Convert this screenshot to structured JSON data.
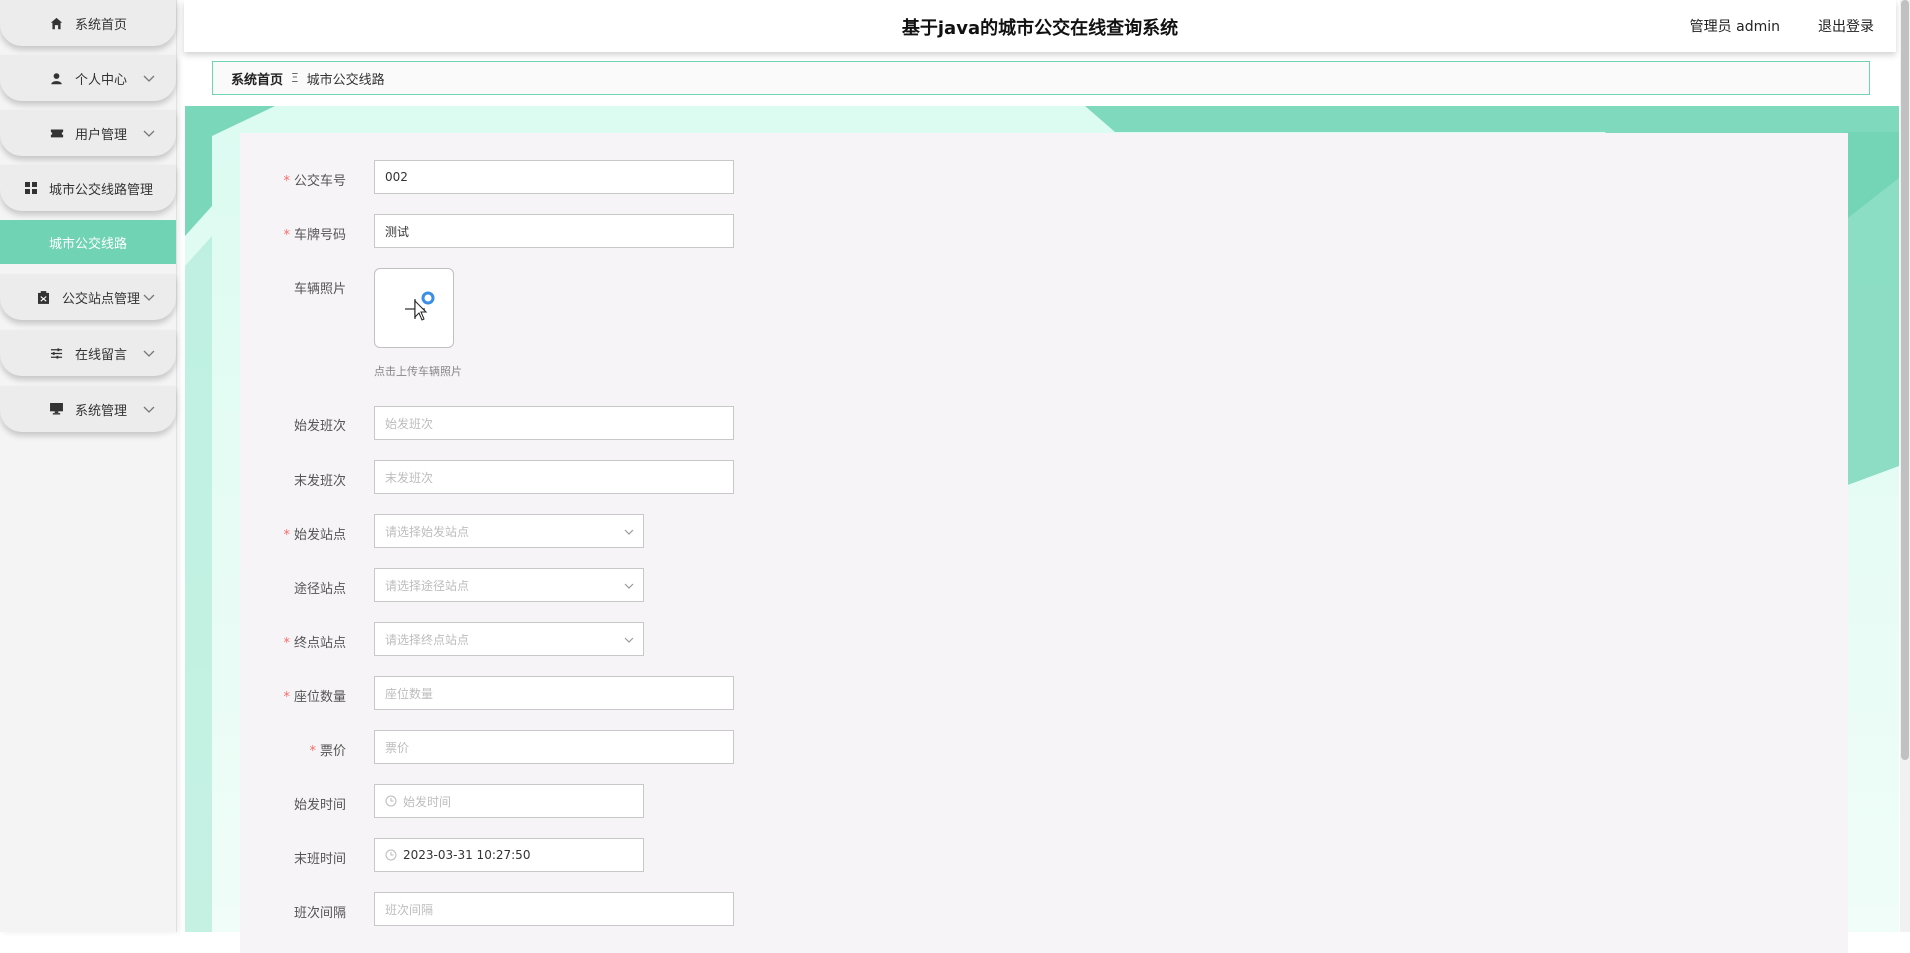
{
  "sidebar": {
    "items": [
      {
        "label": "系统首页",
        "icon": "home-icon",
        "has_chevron": false
      },
      {
        "label": "个人中心",
        "icon": "user-icon",
        "has_chevron": true
      },
      {
        "label": "用户管理",
        "icon": "ticket-icon",
        "has_chevron": true
      },
      {
        "label": "城市公交线路管理",
        "icon": "grid-icon",
        "has_chevron": false
      },
      {
        "label": "公交站点管理",
        "icon": "clipboard-icon",
        "has_chevron": true
      },
      {
        "label": "在线留言",
        "icon": "sliders-icon",
        "has_chevron": true
      },
      {
        "label": "系统管理",
        "icon": "monitor-icon",
        "has_chevron": true
      }
    ],
    "active_sub": "城市公交线路"
  },
  "header": {
    "title": "基于java的城市公交在线查询系统",
    "user": "管理员 admin",
    "logout": "退出登录"
  },
  "breadcrumb": {
    "home": "系统首页",
    "sep": "Ξ",
    "current": "城市公交线路"
  },
  "form": {
    "bus_no": {
      "label": "公交车号",
      "required": true,
      "value": "002"
    },
    "plate_no": {
      "label": "车牌号码",
      "required": true,
      "value": "测试"
    },
    "photo": {
      "label": "车辆照片",
      "hint": "点击上传车辆照片"
    },
    "first_shift": {
      "label": "始发班次",
      "placeholder": "始发班次"
    },
    "last_shift": {
      "label": "末发班次",
      "placeholder": "末发班次"
    },
    "start_station": {
      "label": "始发站点",
      "required": true,
      "placeholder": "请选择始发站点"
    },
    "via_station": {
      "label": "途径站点",
      "placeholder": "请选择途径站点"
    },
    "end_station": {
      "label": "终点站点",
      "required": true,
      "placeholder": "请选择终点站点"
    },
    "seats": {
      "label": "座位数量",
      "required": true,
      "placeholder": "座位数量"
    },
    "fare": {
      "label": "票价",
      "required": true,
      "placeholder": "票价"
    },
    "start_time": {
      "label": "始发时间",
      "placeholder": "始发时间"
    },
    "end_time": {
      "label": "末班时间",
      "value": "2023-03-31 10:27:50"
    },
    "interval": {
      "label": "班次间隔",
      "placeholder": "班次间隔"
    }
  },
  "colors": {
    "accent": "#6fd3b4",
    "required": "#f56c6c"
  }
}
